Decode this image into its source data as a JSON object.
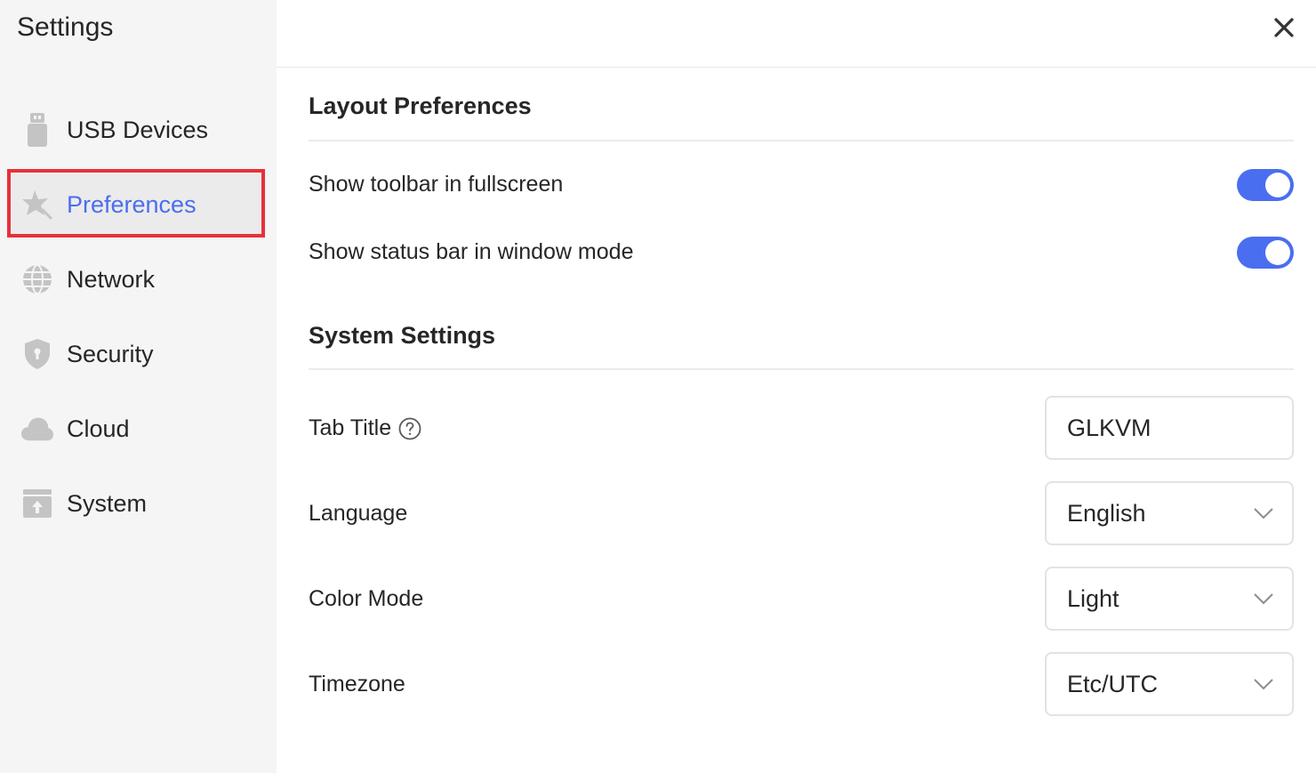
{
  "sidebar": {
    "title": "Settings",
    "items": [
      {
        "label": "USB Devices",
        "icon": "usb-drive-icon"
      },
      {
        "label": "Preferences",
        "icon": "star-wand-icon",
        "active": true
      },
      {
        "label": "Network",
        "icon": "globe-icon"
      },
      {
        "label": "Security",
        "icon": "shield-icon"
      },
      {
        "label": "Cloud",
        "icon": "cloud-icon"
      },
      {
        "label": "System",
        "icon": "upload-box-icon"
      }
    ]
  },
  "header": {
    "close_icon": "close-icon"
  },
  "layout_preferences": {
    "title": "Layout Preferences",
    "show_toolbar_label": "Show toolbar in fullscreen",
    "show_toolbar_on": true,
    "show_status_bar_label": "Show status bar in window mode",
    "show_status_bar_on": true
  },
  "system_settings": {
    "title": "System Settings",
    "tab_title_label": "Tab Title",
    "tab_title_value": "GLKVM",
    "language_label": "Language",
    "language_value": "English",
    "color_mode_label": "Color Mode",
    "color_mode_value": "Light",
    "timezone_label": "Timezone",
    "timezone_value": "Etc/UTC"
  },
  "colors": {
    "accent": "#4a6ef0",
    "highlight_border": "#e8303a",
    "sidebar_bg": "#f5f5f5"
  }
}
